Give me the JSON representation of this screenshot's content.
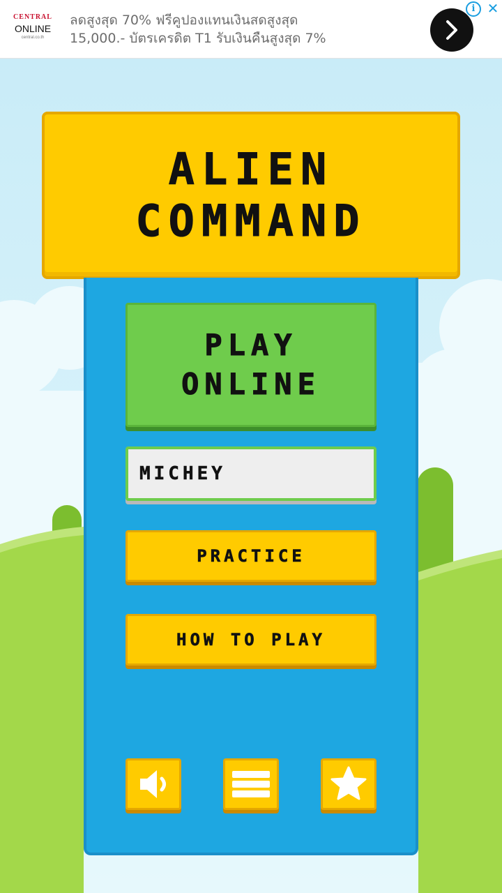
{
  "ad": {
    "brand_top": "CENTRAL",
    "brand_main": "ONLINE",
    "brand_sub": "central.co.th",
    "line1": "ลดสูงสุด 70% ฟรีคูปองแทนเงินสดสูงสุด",
    "line2": "15,000.- บัตรเครดิต T1 รับเงินคืนสูงสุด 7%",
    "info_icon": "info-icon",
    "close_icon": "close-icon",
    "go_icon": "chevron-right-icon"
  },
  "game": {
    "title_line1": "ALIEN",
    "title_line2": "COMMAND",
    "play_line1": "PLAY",
    "play_line2": "ONLINE",
    "player_name": "MICHEY",
    "practice_label": "PRACTICE",
    "how_to_play_label": "HOW TO PLAY",
    "icons": [
      "sound-icon",
      "menu-icon",
      "star-icon"
    ]
  },
  "colors": {
    "sky": "#d4f1fa",
    "grass": "#a3d84a",
    "panel": "#1ea7e1",
    "yellow": "#ffcb00",
    "green_button": "#6fcc4c"
  }
}
